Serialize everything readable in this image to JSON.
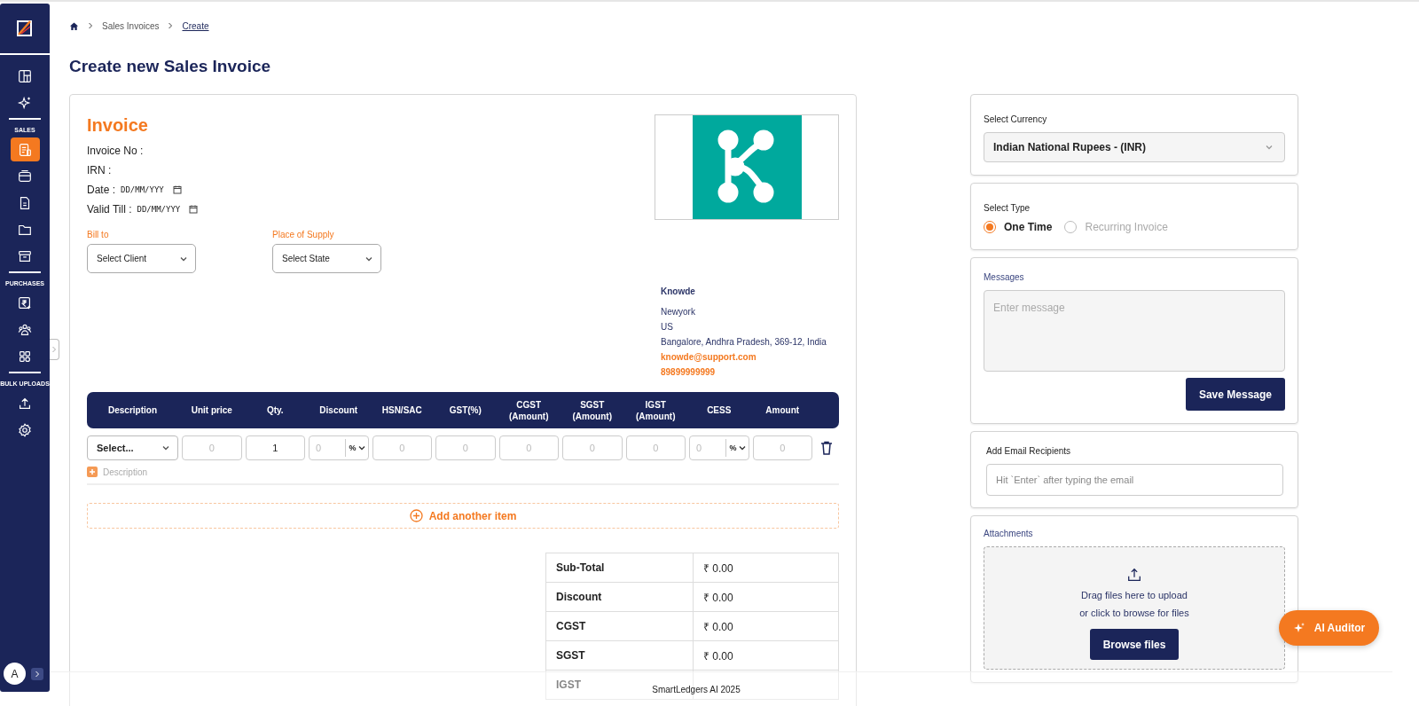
{
  "sidebar": {
    "sections": [
      {
        "items": [
          {
            "selected": false
          },
          {
            "selected": false
          }
        ]
      },
      {
        "label": "SALES",
        "items": [
          {
            "selected": true
          },
          {
            "selected": false
          },
          {
            "selected": false
          },
          {
            "selected": false
          },
          {
            "selected": false
          }
        ]
      },
      {
        "label": "PURCHASES",
        "items": [
          {
            "selected": false
          },
          {
            "selected": false
          },
          {
            "selected": false
          }
        ]
      },
      {
        "label": "BULK UPLOADS",
        "items": [
          {
            "selected": false
          },
          {
            "selected": false
          }
        ]
      }
    ],
    "avatar": "A"
  },
  "breadcrumb": [
    {
      "label": "Sales Invoices",
      "current": false
    },
    {
      "label": "Create",
      "current": true
    }
  ],
  "page_title": "Create new Sales Invoice",
  "invoice": {
    "heading": "Invoice",
    "fields": [
      {
        "kind": "text",
        "label": "Invoice No :"
      },
      {
        "kind": "text",
        "label": "IRN :"
      },
      {
        "kind": "date",
        "label": "Date :",
        "placeholder": "DD/MM/YYY"
      },
      {
        "kind": "date",
        "label": "Valid Till :",
        "placeholder": "DD/MM/YYY"
      }
    ],
    "bill_to": {
      "label": "Bill to",
      "value": "Select Client"
    },
    "place_of_supply": {
      "label": "Place of Supply",
      "value": "Select State"
    },
    "company": {
      "name": "Knowde",
      "address": [
        "Newyork",
        "US",
        "Bangalore, Andhra Pradesh, 369-12, India"
      ],
      "email": "knowde@support.com",
      "phone": "89899999999"
    },
    "items_table": {
      "columns": [
        "Description",
        "Unit price",
        "Qty.",
        "Discount",
        "HSN/SAC",
        "GST(%)",
        "CGST (Amount)",
        "SGST (Amount)",
        "IGST (Amount)",
        "CESS",
        "Amount"
      ],
      "row": [
        {
          "kind": "select",
          "value": "Select..."
        },
        {
          "kind": "input",
          "placeholder": "0"
        },
        {
          "kind": "input",
          "value": "1"
        },
        {
          "kind": "percent",
          "placeholder": "0",
          "unit": "%"
        },
        {
          "kind": "input",
          "placeholder": "0"
        },
        {
          "kind": "input",
          "placeholder": "0"
        },
        {
          "kind": "input",
          "placeholder": "0"
        },
        {
          "kind": "input",
          "placeholder": "0"
        },
        {
          "kind": "input",
          "placeholder": "0"
        },
        {
          "kind": "percent",
          "placeholder": "0",
          "unit": "%"
        },
        {
          "kind": "input",
          "placeholder": "0"
        }
      ],
      "description_link": "Description"
    },
    "add_item": "Add another item",
    "totals": [
      {
        "label": "Sub-Total",
        "value": "₹ 0.00"
      },
      {
        "label": "Discount",
        "value": "₹ 0.00"
      },
      {
        "label": "CGST",
        "value": "₹ 0.00"
      },
      {
        "label": "SGST",
        "value": "₹ 0.00"
      },
      {
        "label": "IGST"
      }
    ]
  },
  "currency": {
    "label": "Select Currency",
    "value": "Indian National Rupees - (INR)"
  },
  "type": {
    "label": "Select Type",
    "options": [
      {
        "label": "One Time",
        "selected": true
      },
      {
        "label": "Recurring Invoice",
        "selected": false
      }
    ]
  },
  "messages": {
    "label": "Messages",
    "placeholder": "Enter message",
    "button": "Save Message"
  },
  "email_recipients": {
    "label": "Add Email Recipients",
    "placeholder": "Hit `Enter` after typing the email"
  },
  "attachments": {
    "label": "Attachments",
    "lines": [
      "Drag files here to upload",
      "or click to browse for files"
    ],
    "button": "Browse files"
  },
  "ai_auditor": "AI Auditor",
  "footer": "SmartLedgers AI 2025"
}
